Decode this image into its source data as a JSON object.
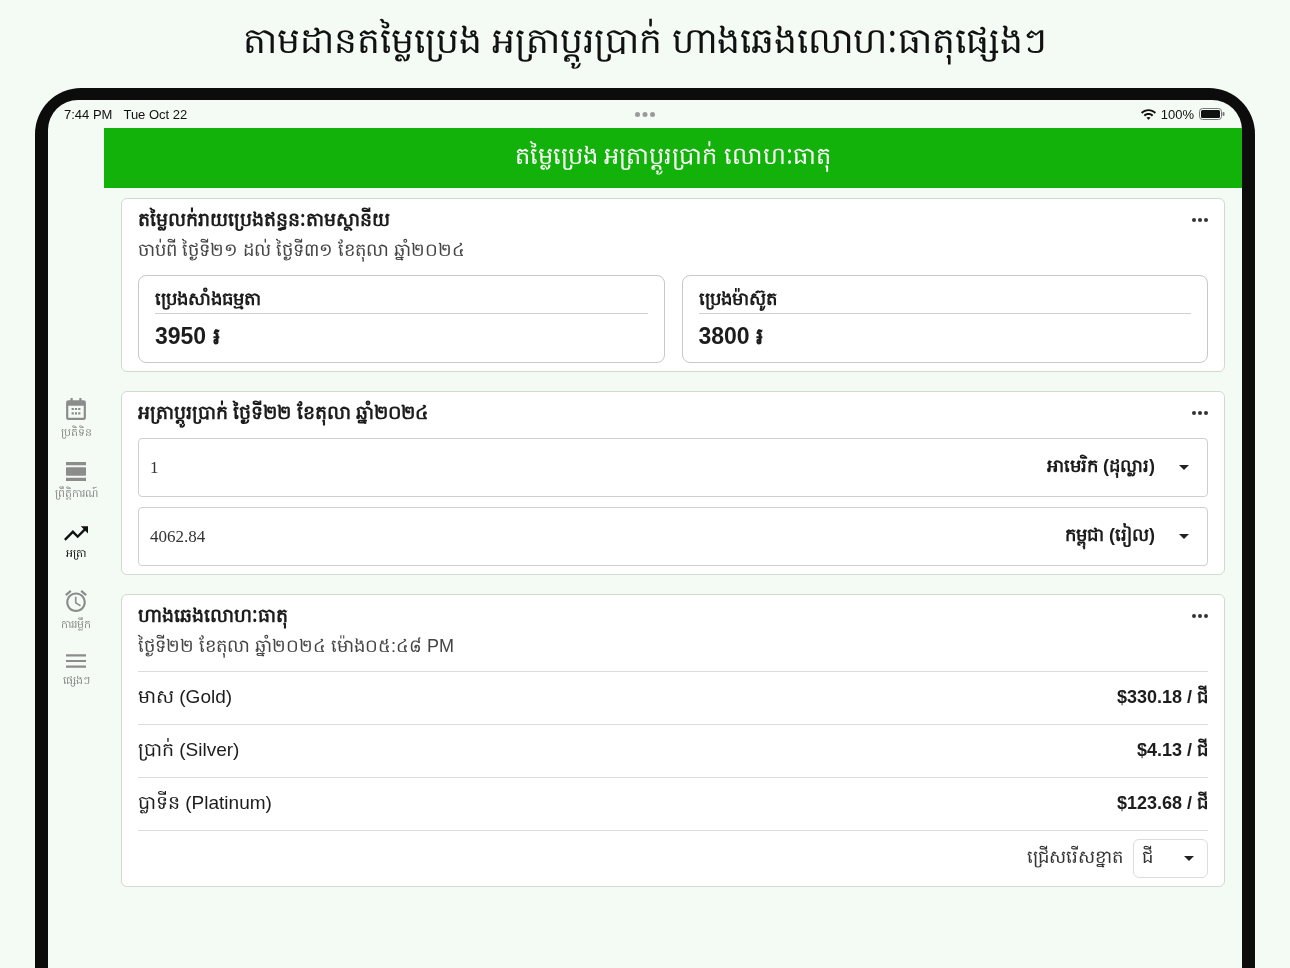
{
  "page_title": "តាមដានតម្លៃប្រេង អត្រាប្តូរប្រាក់ ហាងឆេងលោហៈធាតុផ្សេងៗ",
  "status_bar": {
    "time": "7:44 PM",
    "date": "Tue Oct 22",
    "battery": "100%"
  },
  "header": {
    "title": "តម្លៃប្រេង អត្រាប្តូរប្រាក់ លោហៈធាតុ"
  },
  "sidebar": {
    "items": [
      {
        "kind": "calendar",
        "label": "ប្រតិទិន",
        "selected": false
      },
      {
        "kind": "events",
        "label": "ព្រឹត្តិការណ៍",
        "selected": false
      },
      {
        "kind": "rates",
        "label": "អត្រា",
        "selected": true
      },
      {
        "kind": "reminders",
        "label": "ការរម្លឹក",
        "selected": false
      },
      {
        "kind": "more",
        "label": "ផ្សេងៗ",
        "selected": false
      }
    ]
  },
  "fuel_card": {
    "title": "តម្លៃលក់រាយប្រេងឥន្ធនៈតាមស្ថានីយ",
    "subtitle": "ចាប់ពី ថ្ងៃទី២១ ដល់ ថ្ងៃទី៣១ ខែតុលា ឆ្នាំ២០២៤",
    "prices": [
      {
        "label": "ប្រេងសាំងធម្មតា",
        "value": "3950 ៛"
      },
      {
        "label": "ប្រេងម៉ាស៊ូត",
        "value": "3800 ៛"
      }
    ]
  },
  "exchange_card": {
    "title": "អត្រាប្តូរប្រាក់ ថ្ងៃទី២២ ខែតុលា ឆ្នាំ២០២៤",
    "rows": [
      {
        "amount": "1",
        "currency": "អាមេរិក (ដុល្លារ)"
      },
      {
        "amount": "4062.84",
        "currency": "កម្ពុជា (រៀល)"
      }
    ]
  },
  "metals_card": {
    "title": "ហាងឆេងលោហៈធាតុ",
    "subtitle": "ថ្ងៃទី២២ ខែតុលា ឆ្នាំ២០២៤ ម៉ោង០៥:៤៨ PM",
    "rows": [
      {
        "name": "មាស (Gold)",
        "price": "$330.18 / ជី"
      },
      {
        "name": "ប្រាក់ (Silver)",
        "price": "$4.13 / ជី"
      },
      {
        "name": "ប្លាទីន (Platinum)",
        "price": "$123.68 / ជី"
      }
    ],
    "unit_picker": {
      "label": "ជ្រើសរើសខ្នាត",
      "value": "ជី"
    }
  }
}
